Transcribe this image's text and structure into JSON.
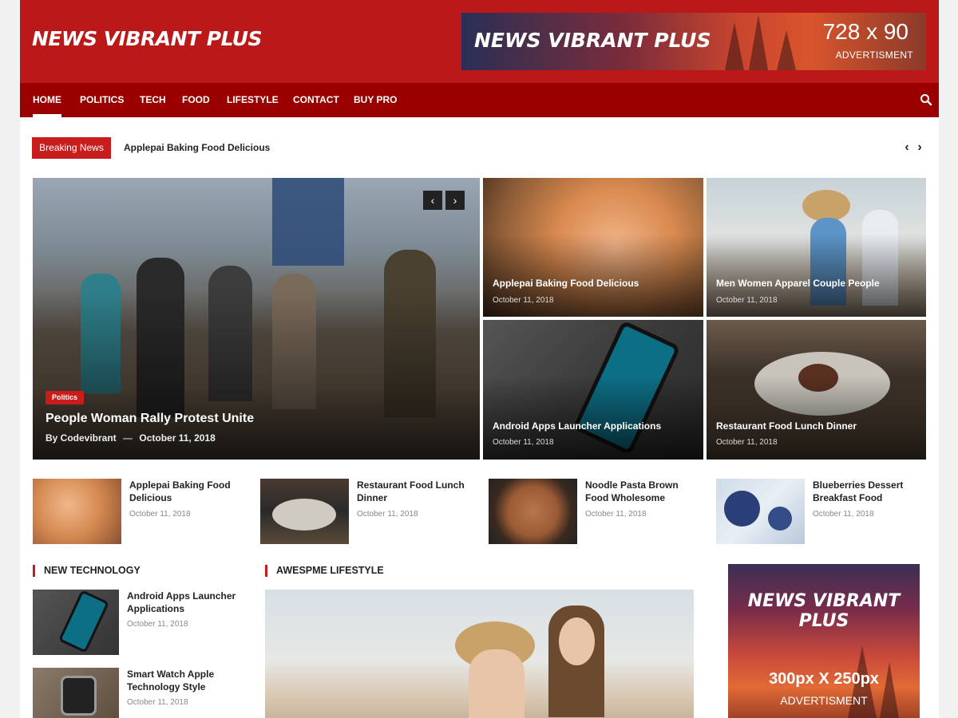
{
  "site": {
    "logo": "News Vibrant Plus"
  },
  "header_ad": {
    "logo": "News Vibrant Plus",
    "size": "728 x 90",
    "label": "ADVERTISMENT"
  },
  "nav": {
    "items": [
      "HOME",
      "POLITICS",
      "TECH",
      "FOOD",
      "LIFESTYLE",
      "CONTACT",
      "BUY PRO"
    ],
    "active": "HOME",
    "search_icon": "search-icon"
  },
  "breaking": {
    "label": "Breaking News",
    "headline": "Applepai Baking Food Delicious",
    "prev_icon": "chevron-left-icon",
    "next_icon": "chevron-right-icon"
  },
  "hero": {
    "category": "Politics",
    "title": "People Woman Rally Protest Unite",
    "author": "By Codevibrant",
    "separator": "—",
    "date": "October 11, 2018"
  },
  "grid": [
    {
      "title": "Applepai Baking Food Delicious",
      "date": "October 11, 2018"
    },
    {
      "title": "Men Women Apparel Couple People",
      "date": "October 11, 2018"
    },
    {
      "title": "Android Apps Launcher Applications",
      "date": "October 11, 2018"
    },
    {
      "title": "Restaurant Food Lunch Dinner",
      "date": "October 11, 2018"
    }
  ],
  "mini_posts": [
    {
      "title": "Applepai Baking Food Delicious",
      "date": "October 11, 2018"
    },
    {
      "title": "Restaurant Food Lunch Dinner",
      "date": "October 11, 2018"
    },
    {
      "title": "Noodle Pasta Brown Food Wholesome",
      "date": "October 11, 2018"
    },
    {
      "title": "Blueberries Dessert Breakfast Food",
      "date": "October 11, 2018"
    }
  ],
  "sections": {
    "tech": {
      "title": "NEW TECHNOLOGY",
      "items": [
        {
          "title": "Android Apps Launcher Applications",
          "date": "October 11, 2018"
        },
        {
          "title": "Smart Watch Apple Technology Style",
          "date": "October 11, 2018"
        }
      ]
    },
    "lifestyle": {
      "title": "AWESPME LIFESTYLE"
    }
  },
  "side_ad": {
    "logo": "News Vibrant Plus",
    "size": "300px X 250px",
    "label": "ADVERTISMENT"
  },
  "colors": {
    "brand_red": "#bb1919",
    "nav_red": "#9a0000",
    "badge_red": "#c91d1d"
  }
}
